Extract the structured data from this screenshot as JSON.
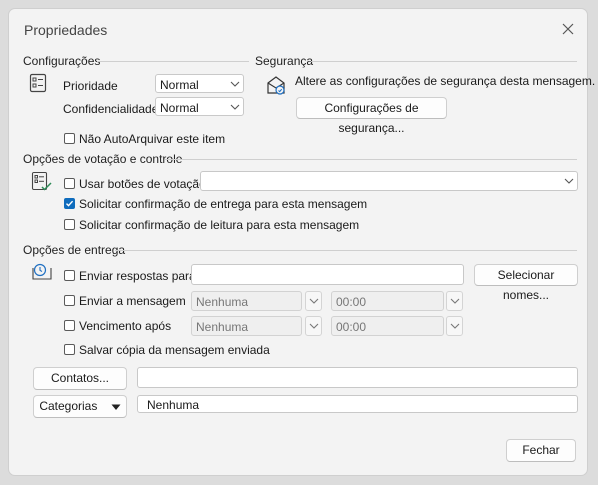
{
  "window": {
    "title": "Propriedades"
  },
  "settings": {
    "group_label": "Configurações",
    "priority_label": "Prioridade",
    "priority_value": "Normal",
    "sensitivity_label": "Confidencialidade",
    "sensitivity_value": "Normal",
    "no_autoarchive_label": "Não AutoArquivar este item",
    "no_autoarchive_checked": false
  },
  "security": {
    "group_label": "Segurança",
    "description": "Altere as configurações de segurança desta mensagem.",
    "button_label": "Configurações de segurança..."
  },
  "voting": {
    "group_label": "Opções de votação e controle",
    "use_voting_label": "Usar botões de votação",
    "use_voting_checked": false,
    "delivery_receipt_label": "Solicitar confirmação de entrega para esta mensagem",
    "delivery_receipt_checked": true,
    "read_receipt_label": "Solicitar confirmação de leitura para esta mensagem",
    "read_receipt_checked": false
  },
  "delivery": {
    "group_label": "Opções de entrega",
    "replies_label": "Enviar respostas para",
    "select_names_label": "Selecionar nomes...",
    "send_label": "Enviar a mensagem",
    "send_date": "Nenhuma",
    "send_time": "00:00",
    "expires_label": "Vencimento após",
    "expires_date": "Nenhuma",
    "expires_time": "00:00",
    "save_copy_label": "Salvar cópia da mensagem enviada"
  },
  "contacts": {
    "button_label": "Contatos..."
  },
  "categories": {
    "button_label": "Categorias",
    "value": "Nenhuma"
  },
  "footer": {
    "close_label": "Fechar"
  }
}
